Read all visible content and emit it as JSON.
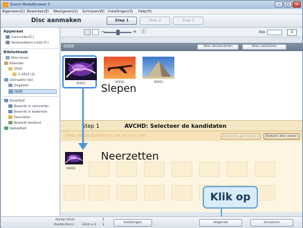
{
  "window": {
    "title": "Everio MediaBrowser 3",
    "controls": [
      "–",
      "□",
      "×"
    ]
  },
  "menu": [
    "Algemeen(G)",
    "Bewerken(E)",
    "Weergeven(V)",
    "Schrijven(W)",
    "Instellingen(S)",
    "Help(H)"
  ],
  "mode": {
    "title": "Disc aanmaken",
    "steps": [
      "Step 1",
      "Step 2",
      "Step 3"
    ]
  },
  "sidebar": {
    "apparaat_heading": "Apparaat",
    "apparaat_items": [
      "Camcorder(E:)",
      "Verwisselbare schijf (F:)"
    ],
    "bibliotheek_heading": "Bibliotheek",
    "bibliotheek_items": [
      "Alles tonen",
      "Kalender",
      "2010",
      "1-2010 (3)",
      "Gemaakte lijst",
      "Ongetitel",
      "0000"
    ],
    "more_items": [
      "Smartlijst",
      "Bewerkt in camcorder",
      "Bewerkt in bewerken",
      "Favorieten",
      "Bewerkt bestand",
      "Uploadlijst"
    ],
    "item_icons": [
      "camcorder-icon",
      "removable-disk-icon",
      "library-icon",
      "calendar-icon",
      "folder-icon",
      "folder-icon",
      "list-icon",
      "list-icon",
      "list-icon",
      "smart-list-icon",
      "smart-list-icon",
      "smart-list-icon",
      "star-icon",
      "edit-icon",
      "upload-icon"
    ]
  },
  "toolbar": {
    "view_icons": [
      "thumbnail-grid-icon",
      "list-view-icon"
    ],
    "zoom_icons": [
      "zoom-out-icon",
      "zoom-in-icon"
    ],
    "info_icon": "info-icon",
    "filter_label": "Alle",
    "sort_icon": "sort-icon"
  },
  "source": {
    "label": "0000",
    "deselect_all": "Alles deselecteren",
    "select_all": "Alles selecteren",
    "thumbnails": [
      {
        "name": "00001",
        "scene": "purple-swirl",
        "selected": true
      },
      {
        "name": "00002",
        "scene": "airplane-sunset",
        "selected": false
      },
      {
        "name": "00003",
        "scene": "pyramid",
        "selected": false
      }
    ]
  },
  "callouts": {
    "drag": "Slepen",
    "drop": "Neerzetten",
    "click": "Klik op"
  },
  "target": {
    "step": "Step 1",
    "title": "AVCHD: Selecteer de kandidaten",
    "hint": "Sleep de bestanden en zet ze hier neer.",
    "btn_remove_selected": "Bestanden geselecteerd",
    "btn_remove_all": "Bestand alles wissen",
    "dropped": [
      {
        "name": "00001",
        "scene": "purple-swirl"
      }
    ]
  },
  "status": {
    "count_label": "Aantal titels:",
    "count_value": "1",
    "discs_label": "Aantal discs:",
    "discs_value": "1",
    "capacity": "12cm x 1",
    "settings": "Instellingen",
    "next": "Volgende",
    "cancel": "Annuleren"
  },
  "colors": {
    "accent_blue": "#3d8be0",
    "arrow_blue": "#4a9ad8",
    "target_bg": "#fdf4e1",
    "header_dark": "#6b7a8f"
  }
}
